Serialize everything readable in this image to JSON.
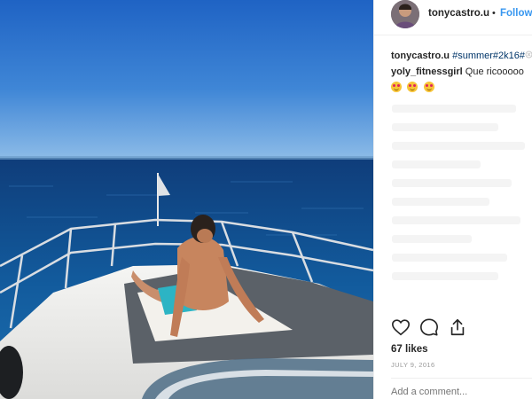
{
  "post": {
    "username": "tonycastro.u",
    "separator": "•",
    "follow_label": "Follow",
    "caption_username": "tonycastro.u",
    "caption_hashtags": "#summer#2k16#",
    "comment_username": "yoly_fitnessgirl",
    "comment_text": "Que ricooooo",
    "comment_emoji": "heart-eyes-emoji x3",
    "likes": "67 likes",
    "date": "JULY 9, 2016",
    "add_comment_placeholder": "Add a comment..."
  },
  "icons": {
    "like": "heart-icon",
    "comment": "comment-bubble-icon",
    "share": "share-icon",
    "more": "more-icon"
  },
  "colors": {
    "follow": "#3897f0",
    "hashtag": "#003569",
    "text": "#262626",
    "muted": "#999999"
  }
}
